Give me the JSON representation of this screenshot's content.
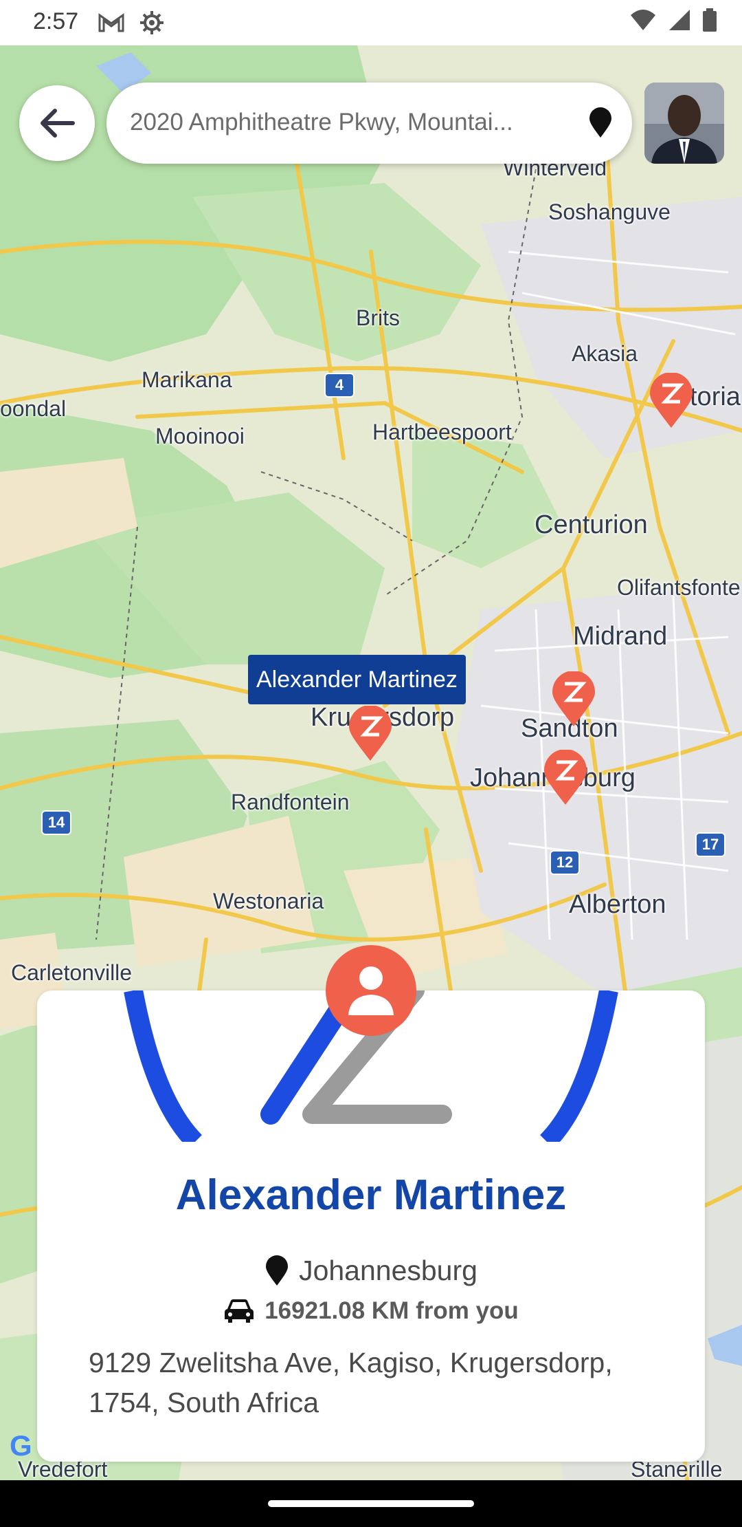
{
  "status_bar": {
    "time": "2:57"
  },
  "search": {
    "address": "2020 Amphitheatre Pkwy, Mountai..."
  },
  "map": {
    "places": [
      {
        "name": "Winterveld",
        "size": "normal"
      },
      {
        "name": "Soshanguve",
        "size": "normal"
      },
      {
        "name": "Brits",
        "size": "normal"
      },
      {
        "name": "Akasia",
        "size": "normal"
      },
      {
        "name": "Marikana",
        "size": "normal"
      },
      {
        "name": "Mooinooi",
        "size": "normal"
      },
      {
        "name": "Hartbeespoort",
        "size": "normal"
      },
      {
        "name": "Centurion",
        "size": "big"
      },
      {
        "name": "Olifantsfonte",
        "size": "normal"
      },
      {
        "name": "Midrand",
        "size": "big"
      },
      {
        "name": "Sandton",
        "size": "big"
      },
      {
        "name": "Johannesburg",
        "size": "big"
      },
      {
        "name": "Randfontein",
        "size": "normal"
      },
      {
        "name": "Westonaria",
        "size": "normal"
      },
      {
        "name": "Alberton",
        "size": "big"
      },
      {
        "name": "Carletonville",
        "size": "normal"
      },
      {
        "name": "Vredefort",
        "size": "normal"
      },
      {
        "name": "Krugersdorp",
        "size": "big"
      },
      {
        "name": "oondal",
        "size": "normal"
      },
      {
        "name": "toria",
        "size": "big"
      },
      {
        "name": "Stanerille",
        "size": "normal"
      }
    ],
    "road_shields": [
      "4",
      "14",
      "12",
      "17"
    ],
    "selected_marker_label": "Alexander Martinez",
    "marker_count": 4,
    "attribution": "G"
  },
  "card": {
    "name": "Alexander Martinez",
    "city": "Johannesburg",
    "distance": "16921.08 KM from you",
    "address": "9129 Zwelitsha Ave, Kagiso, Krugersdorp, 1754, South Africa"
  },
  "colors": {
    "brand_blue": "#1446a8",
    "marker_red": "#f0614b",
    "tooltip_bg": "#0f3e94"
  }
}
